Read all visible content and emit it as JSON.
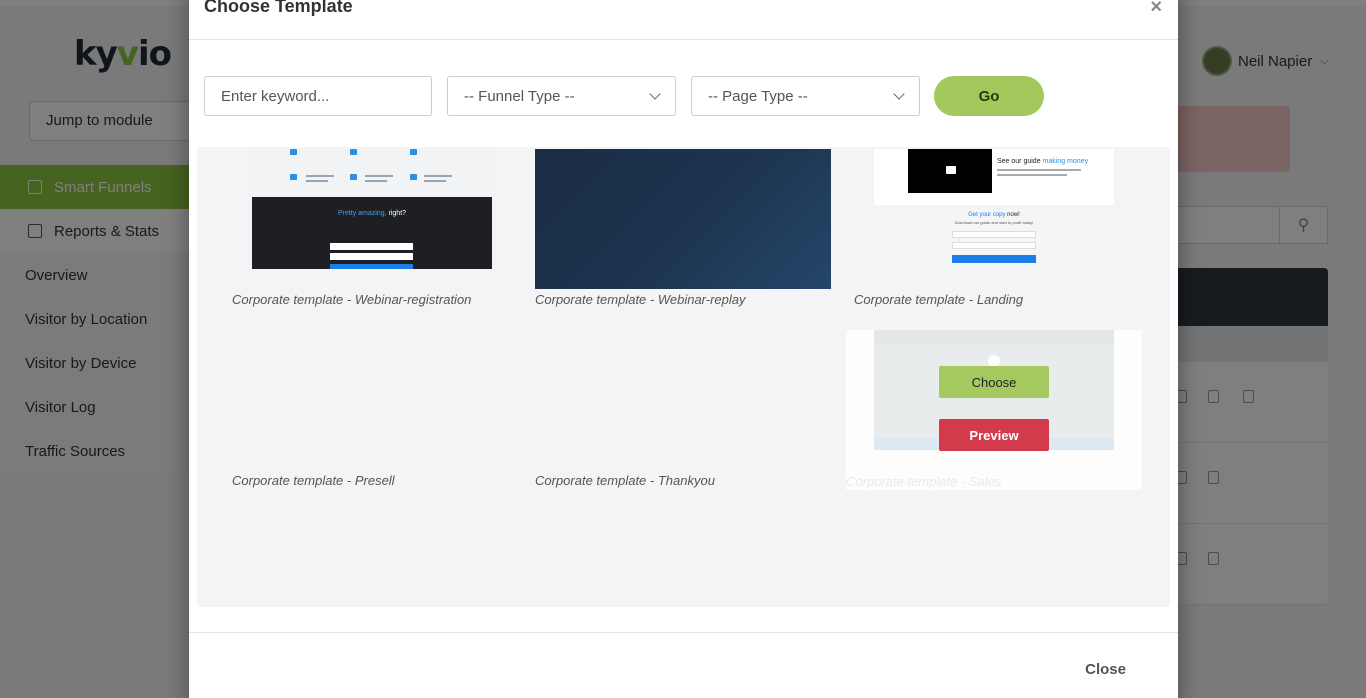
{
  "app": {
    "logo": {
      "pre": "ky",
      "v": "v",
      "post": "io"
    },
    "jump_placeholder": "Jump to module",
    "nav": [
      {
        "label": "Smart Funnels"
      },
      {
        "label": "Reports & Stats"
      },
      {
        "label": "Overview"
      },
      {
        "label": "Visitor by Location"
      },
      {
        "label": "Visitor by Device"
      },
      {
        "label": "Visitor Log"
      },
      {
        "label": "Traffic Sources"
      }
    ],
    "user_name": "Neil Napier"
  },
  "modal": {
    "title": "Choose Template",
    "close_x": "×",
    "keyword_placeholder": "Enter keyword...",
    "funnel_type": "-- Funnel Type --",
    "page_type": "-- Page Type --",
    "go_label": "Go",
    "close_label": "Close",
    "templates": [
      {
        "caption": "Corporate template - Webinar-registration"
      },
      {
        "caption": "Corporate template - Webinar-replay"
      },
      {
        "caption": "Corporate template - Landing"
      },
      {
        "caption": "Corporate template - Presell"
      },
      {
        "caption": "Corporate template - Thankyou"
      },
      {
        "caption": "Corporate template - Sales"
      }
    ],
    "hover_actions": {
      "choose": "Choose",
      "preview": "Preview"
    },
    "thumb_webinar_reg": {
      "headline_accent": "Pretty amazing,",
      "headline_rest": " right?"
    },
    "thumb_landing": {
      "headline": "See our guide ",
      "headline_accent": "making money",
      "cta_accent": "Get your copy",
      "cta_rest": " now!",
      "cta_sub": "Download our guide and start to profit today!"
    }
  },
  "colors": {
    "accent_green": "#8dc63f",
    "go_green": "#a3c95c",
    "preview_red": "#d33a4c"
  }
}
